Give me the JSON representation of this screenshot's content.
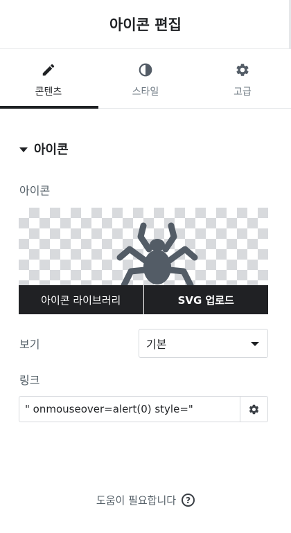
{
  "header": {
    "title": "아이콘 편집"
  },
  "tabs": [
    {
      "label": "콘텐츠",
      "icon": "pencil-icon",
      "active": true
    },
    {
      "label": "스타일",
      "icon": "contrast-icon",
      "active": false
    },
    {
      "label": "고급",
      "icon": "gear-icon",
      "active": false
    }
  ],
  "section": {
    "title": "아이콘"
  },
  "icon_field": {
    "label": "아이콘",
    "preview_icon": "spider-icon",
    "library_button": "아이콘 라이브러리",
    "upload_button": "SVG 업로드"
  },
  "view_field": {
    "label": "보기",
    "value": "기본"
  },
  "link_field": {
    "label": "링크",
    "value": "\" onmouseover=alert(0) style=\""
  },
  "help": {
    "text": "도움이 필요합니다",
    "icon_glyph": "?"
  },
  "colors": {
    "text": "#1f2124",
    "muted": "#6d7882",
    "dark": "#202124",
    "icon": "#535c66"
  }
}
